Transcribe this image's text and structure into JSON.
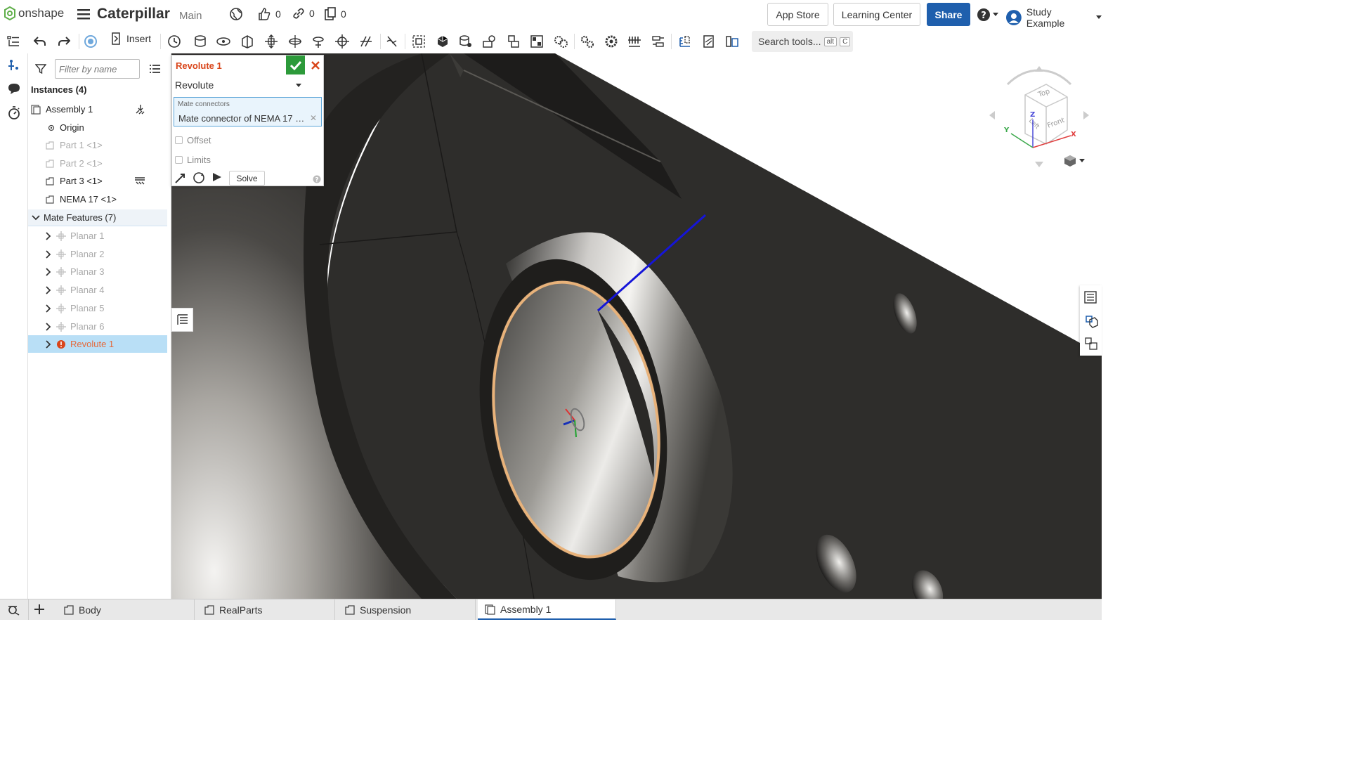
{
  "app": {
    "brand": "onshape",
    "doc_title": "Caterpillar",
    "branch": "Main"
  },
  "stats": {
    "likes": "0",
    "links": "0",
    "copies": "0"
  },
  "topbar": {
    "app_store": "App Store",
    "learning_center": "Learning Center",
    "share": "Share",
    "user_name": "Study Example"
  },
  "toolbar": {
    "insert": "Insert",
    "search_tools": "Search tools...",
    "shortcut_mod": "alt",
    "shortcut_key": "C"
  },
  "panel": {
    "filter_placeholder": "Filter by name",
    "instances_header": "Instances (4)",
    "instances": [
      {
        "label": "Assembly 1"
      },
      {
        "label": "Origin"
      },
      {
        "label": "Part 1 <1>"
      },
      {
        "label": "Part 2 <1>"
      },
      {
        "label": "Part 3 <1>"
      },
      {
        "label": "NEMA 17 <1>"
      }
    ],
    "mate_header": "Mate Features (7)",
    "mates": [
      {
        "label": "Planar 1"
      },
      {
        "label": "Planar 2"
      },
      {
        "label": "Planar 3"
      },
      {
        "label": "Planar 4"
      },
      {
        "label": "Planar 5"
      },
      {
        "label": "Planar 6"
      },
      {
        "label": "Revolute 1"
      }
    ]
  },
  "mate_dialog": {
    "title": "Revolute 1",
    "type": "Revolute",
    "connectors_label": "Mate connectors",
    "connector_value": "Mate connector of NEMA 17 <...",
    "offset": "Offset",
    "limits": "Limits",
    "solve": "Solve"
  },
  "viewcube": {
    "top": "Top",
    "left": "Left",
    "front": "Front",
    "axis_x": "X",
    "axis_y": "Y",
    "axis_z": "Z"
  },
  "tabs": [
    {
      "label": "Body"
    },
    {
      "label": "RealParts"
    },
    {
      "label": "Suspension"
    },
    {
      "label": "Assembly 1"
    }
  ],
  "colors": {
    "accent": "#1f5fad",
    "ok": "#2c9a3a",
    "error": "#d9451a",
    "selection": "#b9dff6"
  }
}
